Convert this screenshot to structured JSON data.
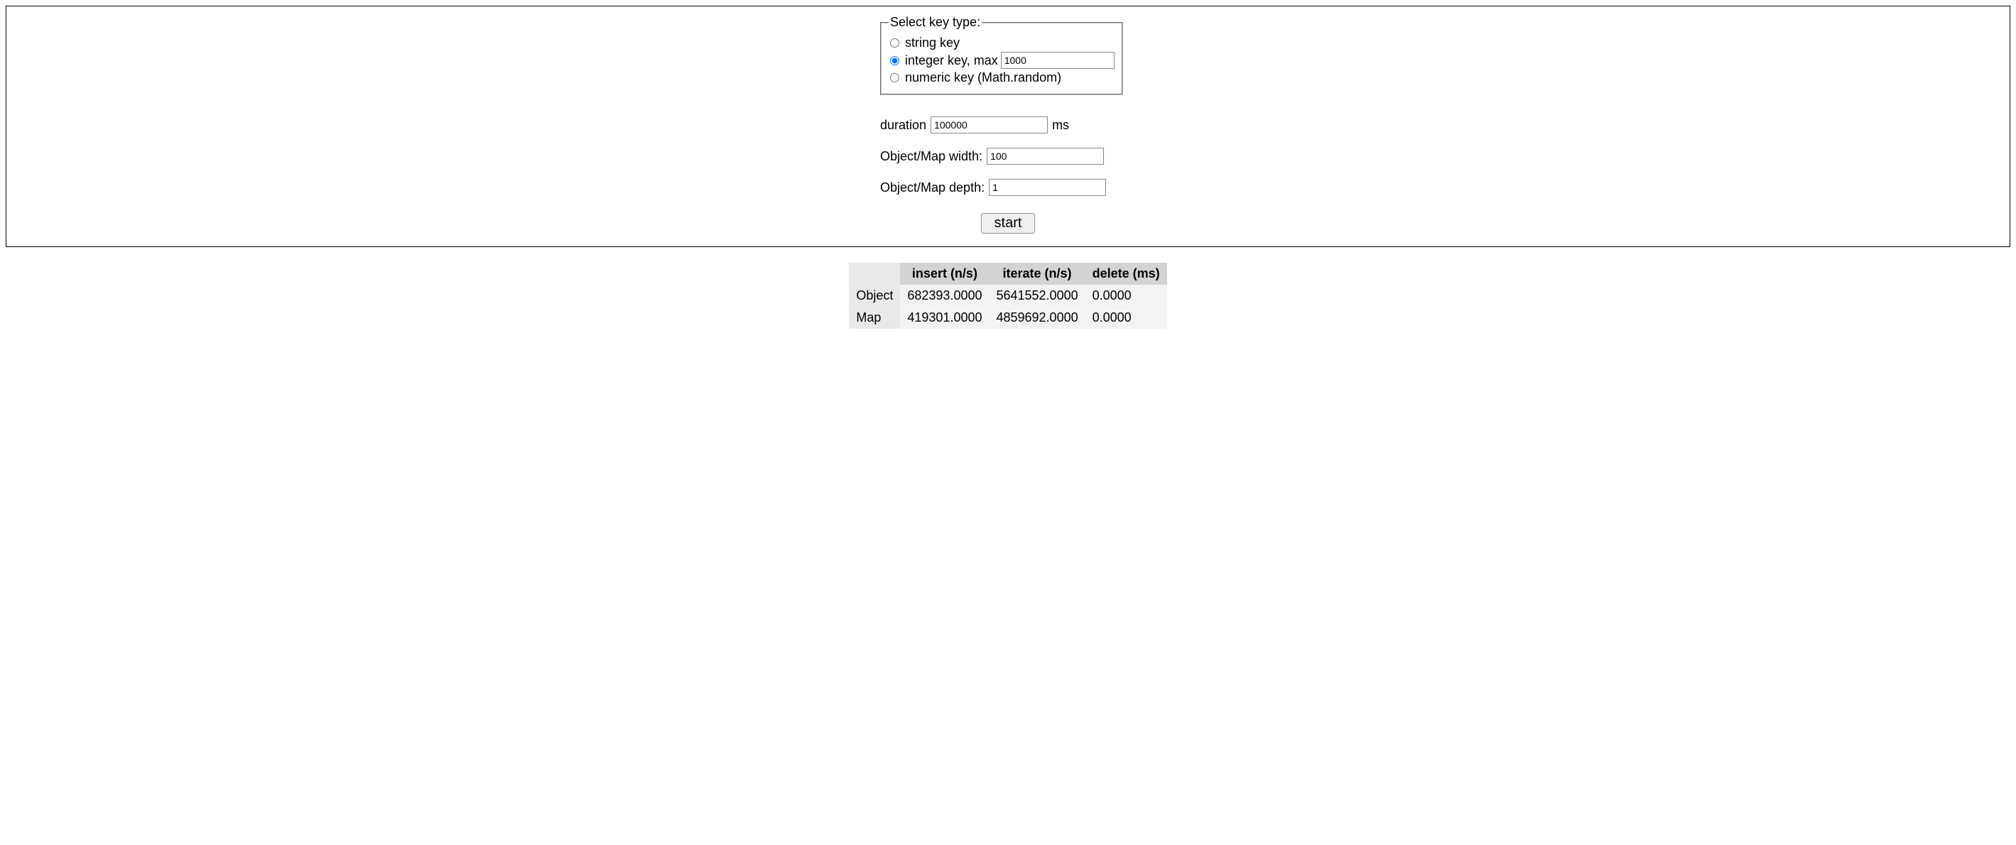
{
  "fieldset": {
    "legend": "Select key type:",
    "option_string": "string key",
    "option_integer_prefix": "integer key, max",
    "option_integer_value": "1000",
    "option_numeric": "numeric key (Math.random)",
    "selected": "integer"
  },
  "duration": {
    "label": "duration",
    "value": "100000",
    "unit": "ms"
  },
  "width": {
    "label": "Object/Map width:",
    "value": "100"
  },
  "depth": {
    "label": "Object/Map depth:",
    "value": "1"
  },
  "start_button": "start",
  "results": {
    "headers": {
      "corner": "",
      "insert": "insert (n/s)",
      "iterate": "iterate (n/s)",
      "delete": "delete (ms)"
    },
    "rows": [
      {
        "label": "Object",
        "insert": "682393.0000",
        "iterate": "5641552.0000",
        "delete": "0.0000"
      },
      {
        "label": "Map",
        "insert": "419301.0000",
        "iterate": "4859692.0000",
        "delete": "0.0000"
      }
    ]
  }
}
